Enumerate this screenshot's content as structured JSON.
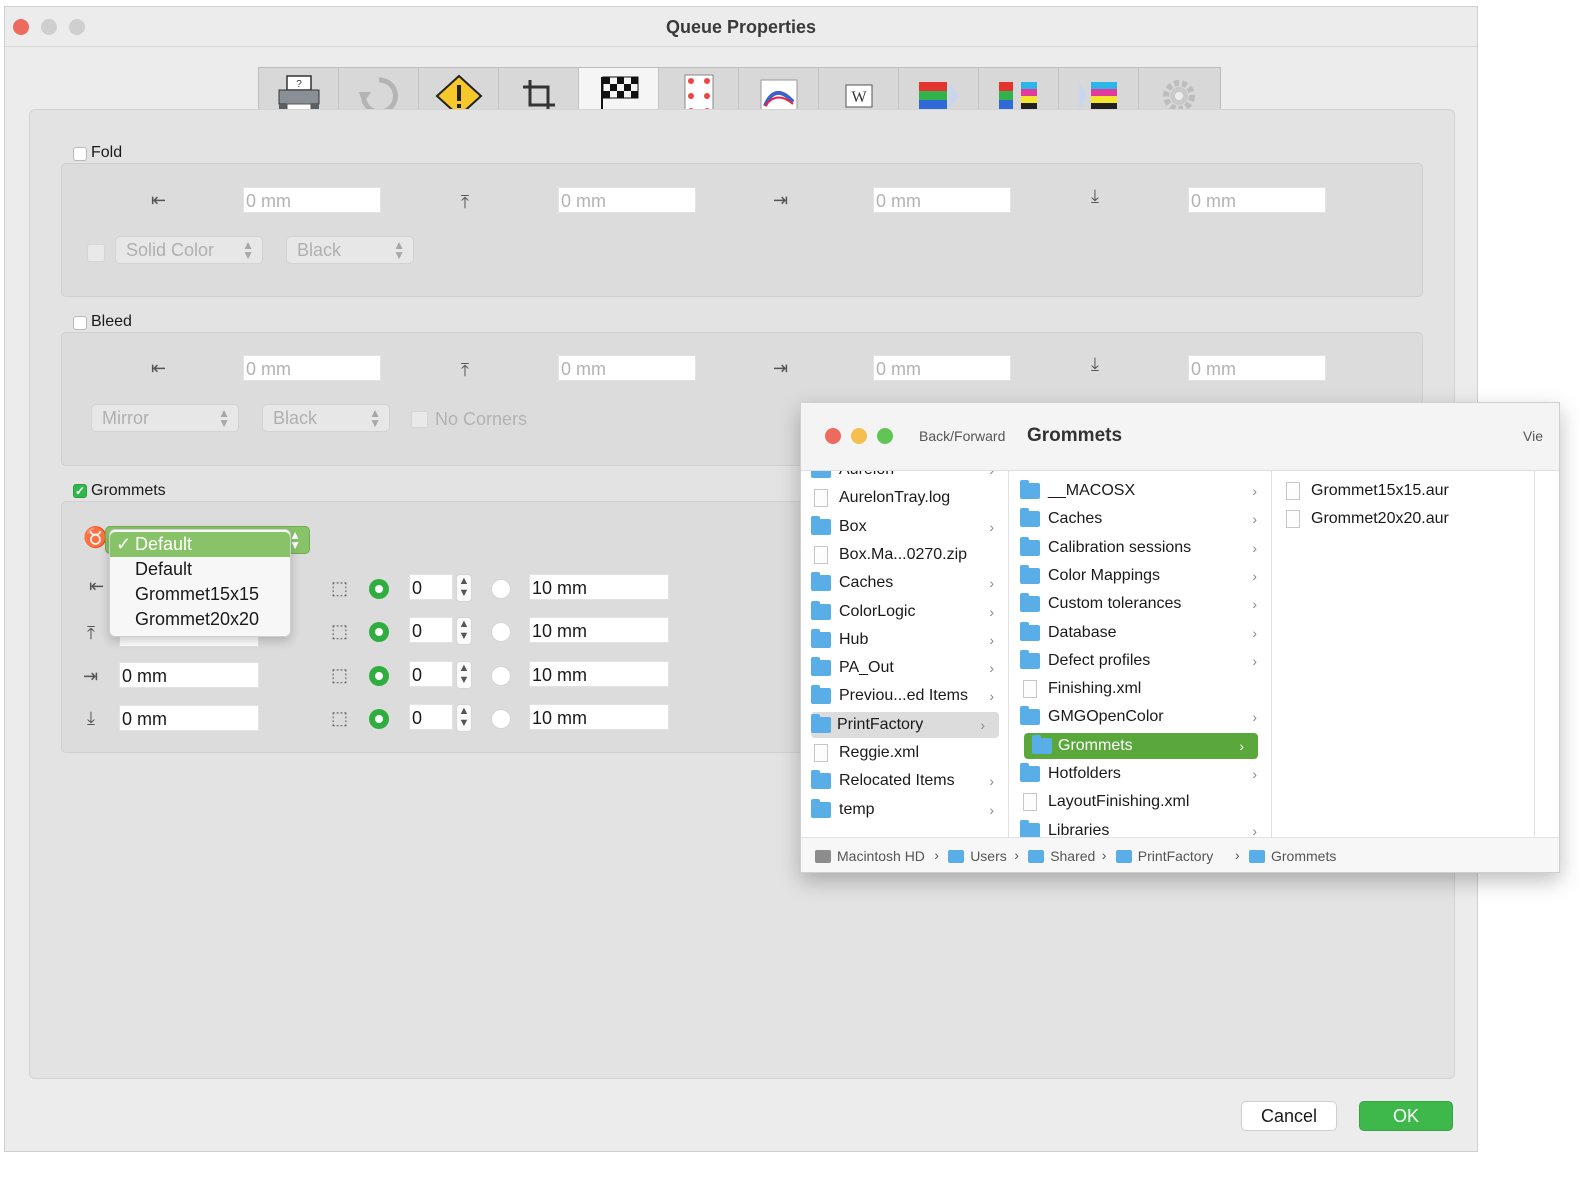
{
  "window": {
    "title": "Queue Properties"
  },
  "toolbar": {
    "buttons": [
      {
        "icon": "printer-icon"
      },
      {
        "icon": "rotate-icon"
      },
      {
        "icon": "warning-icon"
      },
      {
        "icon": "crop-icon"
      },
      {
        "icon": "checkered-flag-icon"
      },
      {
        "icon": "grommet-layout-icon"
      },
      {
        "icon": "color-curve-icon"
      },
      {
        "icon": "text-icon"
      },
      {
        "icon": "rgb-input-icon"
      },
      {
        "icon": "color-convert-icon"
      },
      {
        "icon": "cmyk-output-icon"
      },
      {
        "icon": "gear-icon"
      }
    ],
    "active_index": 4
  },
  "fold": {
    "label": "Fold",
    "checked": false,
    "fields": [
      "0 mm",
      "0 mm",
      "0 mm",
      "0 mm"
    ],
    "style_popup": "Solid Color",
    "color_popup": "Black"
  },
  "bleed": {
    "label": "Bleed",
    "checked": false,
    "fields": [
      "0 mm",
      "0 mm",
      "0 mm",
      "0 mm"
    ],
    "mode_popup": "Mirror",
    "color_popup": "Black",
    "no_corners_label": "No Corners"
  },
  "grommets": {
    "label": "Grommets",
    "checked": true,
    "preset_selected": "Default",
    "preset_options": [
      "Default",
      "Default",
      "Grommet15x15",
      "Grommet20x20"
    ],
    "margin_fields": [
      "0 mm",
      "0 mm"
    ],
    "counts": [
      "0",
      "0",
      "0",
      "0"
    ],
    "distances": [
      "10 mm",
      "10 mm",
      "10 mm",
      "10 mm"
    ]
  },
  "buttons": {
    "cancel": "Cancel",
    "ok": "OK"
  },
  "finder": {
    "nav_label": "Back/Forward",
    "title": "Grommets",
    "view_label": "Vie",
    "col1": [
      {
        "name": "Aurelon",
        "type": "folder",
        "chev": true
      },
      {
        "name": "AurelonTray.log",
        "type": "file",
        "chev": false
      },
      {
        "name": "Box",
        "type": "folder",
        "chev": true
      },
      {
        "name": "Box.Ma...0270.zip",
        "type": "file",
        "chev": false
      },
      {
        "name": "Caches",
        "type": "folder",
        "chev": true
      },
      {
        "name": "ColorLogic",
        "type": "folder",
        "chev": true
      },
      {
        "name": "Hub",
        "type": "folder",
        "chev": true
      },
      {
        "name": "PA_Out",
        "type": "folder",
        "chev": true
      },
      {
        "name": "Previou...ed Items",
        "type": "folder",
        "chev": true
      },
      {
        "name": "PrintFactory",
        "type": "folder",
        "chev": true,
        "selected": "gray"
      },
      {
        "name": "Reggie.xml",
        "type": "file",
        "chev": false
      },
      {
        "name": "Relocated Items",
        "type": "folder",
        "chev": true
      },
      {
        "name": "temp",
        "type": "folder",
        "chev": true
      }
    ],
    "col2": [
      {
        "name": "__MACOSX",
        "type": "folder",
        "chev": true
      },
      {
        "name": "Caches",
        "type": "folder",
        "chev": true
      },
      {
        "name": "Calibration sessions",
        "type": "folder",
        "chev": true
      },
      {
        "name": "Color Mappings",
        "type": "folder",
        "chev": true
      },
      {
        "name": "Custom tolerances",
        "type": "folder",
        "chev": true
      },
      {
        "name": "Database",
        "type": "folder",
        "chev": true
      },
      {
        "name": "Defect profiles",
        "type": "folder",
        "chev": true
      },
      {
        "name": "Finishing.xml",
        "type": "file",
        "chev": false
      },
      {
        "name": "GMGOpenColor",
        "type": "folder",
        "chev": true
      },
      {
        "name": "Grommets",
        "type": "folder",
        "chev": true,
        "selected": "green"
      },
      {
        "name": "Hotfolders",
        "type": "folder",
        "chev": true
      },
      {
        "name": "LayoutFinishing.xml",
        "type": "file",
        "chev": false
      },
      {
        "name": "Libraries",
        "type": "folder",
        "chev": true
      }
    ],
    "col3": [
      {
        "name": "Grommet15x15.aur",
        "type": "file"
      },
      {
        "name": "Grommet20x20.aur",
        "type": "file"
      }
    ],
    "path": [
      "Macintosh HD",
      "Users",
      "Shared",
      "PrintFactory",
      "Grommets"
    ]
  },
  "colors": {
    "accent_green": "#5aa83c",
    "ok_button": "#3fb84b",
    "radio_on": "#2fae3f",
    "close": "#ed6a5e",
    "minimize": "#f5bf4f",
    "maximize": "#61c554",
    "disabled_traffic": "#cfcfcf"
  }
}
